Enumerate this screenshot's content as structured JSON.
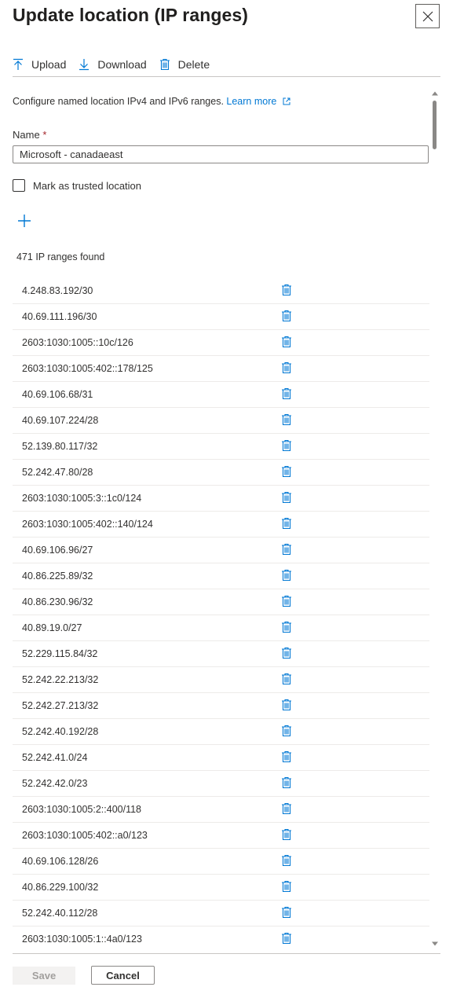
{
  "panel": {
    "title": "Update location (IP ranges)",
    "close_icon": "close-icon"
  },
  "toolbar": {
    "upload_label": "Upload",
    "download_label": "Download",
    "delete_label": "Delete"
  },
  "form": {
    "description": "Configure named location IPv4 and IPv6 ranges.",
    "learn_more": "Learn more",
    "name_label": "Name",
    "required_mark": "*",
    "name_value": "Microsoft - canadaeast",
    "trusted_label": "Mark as trusted location",
    "count_text": "471 IP ranges found"
  },
  "ip_ranges": [
    "4.248.83.192/30",
    "40.69.111.196/30",
    "2603:1030:1005::10c/126",
    "2603:1030:1005:402::178/125",
    "40.69.106.68/31",
    "40.69.107.224/28",
    "52.139.80.117/32",
    "52.242.47.80/28",
    "2603:1030:1005:3::1c0/124",
    "2603:1030:1005:402::140/124",
    "40.69.106.96/27",
    "40.86.225.89/32",
    "40.86.230.96/32",
    "40.89.19.0/27",
    "52.229.115.84/32",
    "52.242.22.213/32",
    "52.242.27.213/32",
    "52.242.40.192/28",
    "52.242.41.0/24",
    "52.242.42.0/23",
    "2603:1030:1005:2::400/118",
    "2603:1030:1005:402::a0/123",
    "40.69.106.128/26",
    "40.86.229.100/32",
    "52.242.40.112/28",
    "2603:1030:1005:1::4a0/123"
  ],
  "footer": {
    "save_label": "Save",
    "cancel_label": "Cancel"
  },
  "colors": {
    "accent": "#0078d4",
    "required": "#a4262c",
    "disabled_bg": "#f3f2f1"
  }
}
